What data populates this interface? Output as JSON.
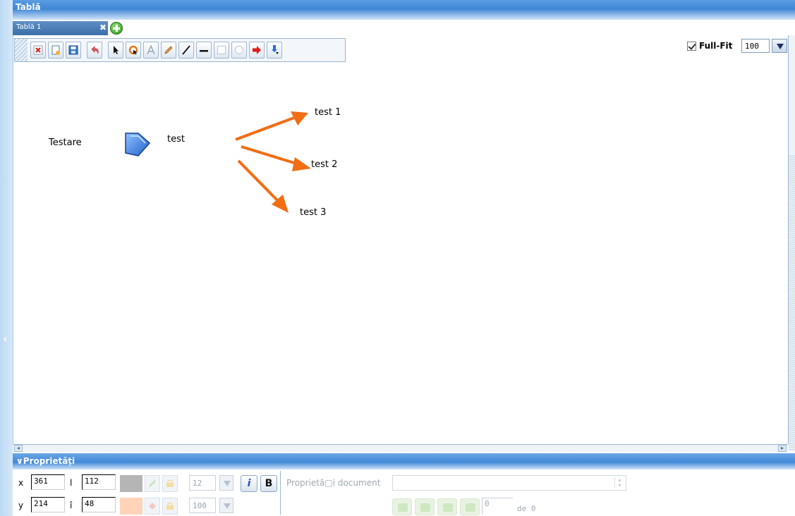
{
  "window": {
    "title": "Tablă"
  },
  "tabs": [
    {
      "label": "Tablă 1",
      "close_label": "✖"
    }
  ],
  "toolbar": {
    "tools": [
      "delete-icon",
      "new-page-icon",
      "save-icon",
      "undo-icon",
      "select-pointer-icon",
      "lasso-icon",
      "text-icon",
      "pencil-icon",
      "line-icon",
      "thick-line-icon",
      "rectangle-icon",
      "circle-icon",
      "arrow-icon",
      "fill-dropdown-icon"
    ]
  },
  "zoom": {
    "fullfit_label": "Full-Fit",
    "fullfit_checked": true,
    "value": "100"
  },
  "diagram": {
    "labels": {
      "testare": "Testare",
      "test": "test",
      "test1": "test 1",
      "test2": "test 2",
      "test3": "test 3"
    },
    "colors": {
      "arrow": "#f26d14",
      "shape_blue": "#2b6fd8"
    }
  },
  "properties": {
    "title": "Proprietăţi",
    "x_label": "x",
    "x_value": "361",
    "w_label": "l",
    "w_value": "112",
    "y_label": "y",
    "y_value": "214",
    "h_label": "î",
    "h_value": "48",
    "font_size": "12",
    "opacity": "100",
    "italic_label": "i",
    "bold_label": "B",
    "stroke_color": "#b5b5b5",
    "fill_color": "#ffd3b8",
    "doc_props_label": "Proprietă□i document",
    "page_current": "0",
    "page_of_label": "de 0"
  }
}
